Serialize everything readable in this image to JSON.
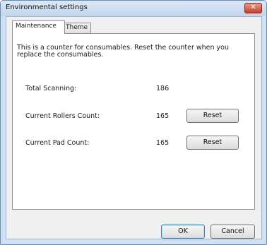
{
  "window": {
    "title": "Environmental settings",
    "close_glyph": "✕"
  },
  "tabs": [
    {
      "label": "Maintenance",
      "active": true
    },
    {
      "label": "Theme",
      "active": false
    }
  ],
  "maintenance": {
    "description": "This is a counter for consumables. Reset the counter when you replace the consumables.",
    "rows": [
      {
        "label": "Total Scanning:",
        "value": "186"
      },
      {
        "label": "Current Rollers Count:",
        "value": "165",
        "button": "Reset"
      },
      {
        "label": "Current Pad Count:",
        "value": "165",
        "button": "Reset"
      }
    ]
  },
  "footer": {
    "ok_label": "OK",
    "cancel_label": "Cancel"
  },
  "icons": {
    "close": "close-icon"
  },
  "colors": {
    "title_bar": "#c2d6ec",
    "close_button": "#c1402c",
    "client_background": "#f0f0f0"
  }
}
